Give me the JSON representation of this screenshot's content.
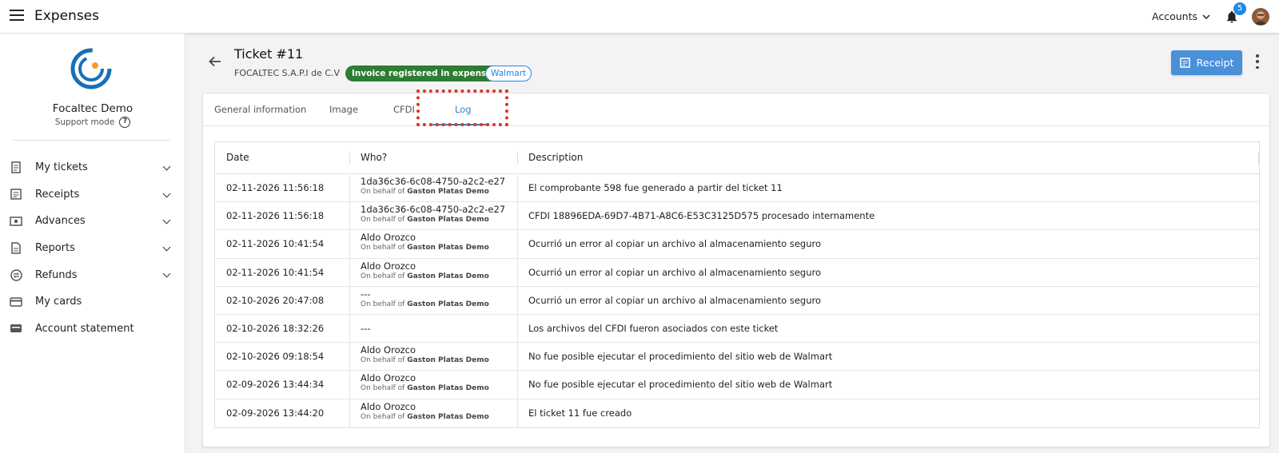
{
  "header": {
    "app_title": "Expenses",
    "accounts_label": "Accounts",
    "notification_count": "5"
  },
  "sidebar": {
    "org_name": "Focaltec Demo",
    "support_mode": "Support mode",
    "items": [
      {
        "label": "My tickets",
        "icon": "receipt-icon",
        "expandable": true
      },
      {
        "label": "Receipts",
        "icon": "document-icon",
        "expandable": true
      },
      {
        "label": "Advances",
        "icon": "cash-icon",
        "expandable": true
      },
      {
        "label": "Reports",
        "icon": "report-icon",
        "expandable": true
      },
      {
        "label": "Refunds",
        "icon": "exchange-icon",
        "expandable": true
      },
      {
        "label": "My cards",
        "icon": "card-icon",
        "expandable": false
      },
      {
        "label": "Account statement",
        "icon": "wallet-icon",
        "expandable": false
      }
    ]
  },
  "ticket": {
    "title": "Ticket #11",
    "company": "FOCALTEC S.A.P.I de C.V",
    "status_chip": "Invoice registered in expenses",
    "merchant_chip": "Walmart",
    "receipt_button": "Receipt"
  },
  "tabs": [
    {
      "label": "General information",
      "active": false
    },
    {
      "label": "Image",
      "active": false
    },
    {
      "label": "CFDI",
      "active": false
    },
    {
      "label": "Log",
      "active": true
    }
  ],
  "table": {
    "headers": [
      "Date",
      "Who?",
      "Description"
    ],
    "behalf_prefix": "On behalf of",
    "rows": [
      {
        "date": "02-11-2026 11:56:18",
        "who": "1da36c36-6c08-4750-a2c2-e27",
        "behalf": "Gaston Platas Demo",
        "description": "El comprobante 598 fue generado a partir del ticket 11"
      },
      {
        "date": "02-11-2026 11:56:18",
        "who": "1da36c36-6c08-4750-a2c2-e27",
        "behalf": "Gaston Platas Demo",
        "description": "CFDI 18896EDA-69D7-4B71-A8C6-E53C3125D575 procesado internamente"
      },
      {
        "date": "02-11-2026 10:41:54",
        "who": "Aldo Orozco",
        "behalf": "Gaston Platas Demo",
        "description": "Ocurrió un error al copiar un archivo al almacenamiento seguro"
      },
      {
        "date": "02-11-2026 10:41:54",
        "who": "Aldo Orozco",
        "behalf": "Gaston Platas Demo",
        "description": "Ocurrió un error al copiar un archivo al almacenamiento seguro"
      },
      {
        "date": "02-10-2026 20:47:08",
        "who": "---",
        "behalf": "Gaston Platas Demo",
        "description": "Ocurrió un error al copiar un archivo al almacenamiento seguro"
      },
      {
        "date": "02-10-2026 18:32:26",
        "who": "---",
        "behalf": null,
        "description": "Los archivos del CFDI fueron asociados con este ticket"
      },
      {
        "date": "02-10-2026 09:18:54",
        "who": "Aldo Orozco",
        "behalf": "Gaston Platas Demo",
        "description": "No fue posible ejecutar el procedimiento del sitio web de Walmart"
      },
      {
        "date": "02-09-2026 13:44:34",
        "who": "Aldo Orozco",
        "behalf": "Gaston Platas Demo",
        "description": "No fue posible ejecutar el procedimiento del sitio web de Walmart"
      },
      {
        "date": "02-09-2026 13:44:20",
        "who": "Aldo Orozco",
        "behalf": "Gaston Platas Demo",
        "description": "El ticket 11 fue creado"
      }
    ]
  },
  "colors": {
    "accent": "#3b82c4",
    "status_green": "#2e7d32",
    "button_blue": "#4a90d9",
    "highlight_red": "#e03020"
  }
}
